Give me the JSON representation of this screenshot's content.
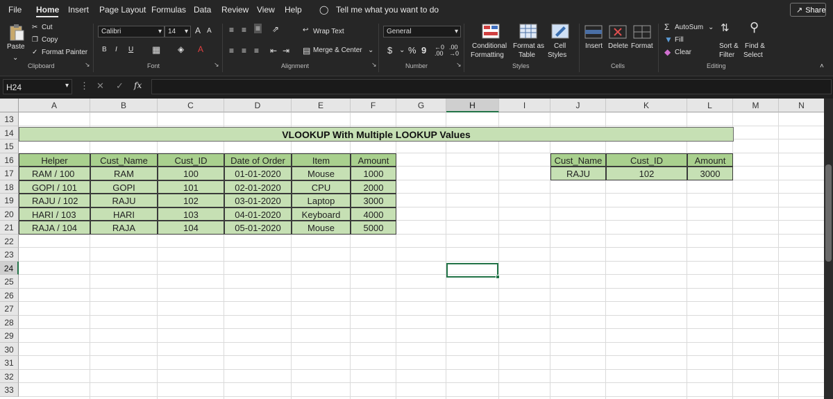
{
  "menu": {
    "tabs": [
      "File",
      "Home",
      "Insert",
      "Page Layout",
      "Formulas",
      "Data",
      "Review",
      "View",
      "Help"
    ],
    "tell_me": "Tell me what you want to do",
    "share": "Share"
  },
  "ribbon": {
    "clipboard": {
      "paste": "Paste",
      "cut": "Cut",
      "copy": "Copy",
      "format_painter": "Format Painter",
      "group": "Clipboard"
    },
    "font": {
      "name": "Calibri",
      "size": "14",
      "bold": "B",
      "italic": "I",
      "underline": "U",
      "group": "Font",
      "grow": "A",
      "shrink": "A"
    },
    "alignment": {
      "wrap": "Wrap Text",
      "merge": "Merge & Center",
      "group": "Alignment"
    },
    "number": {
      "format": "General",
      "currency": "$",
      "percent": "%",
      "comma": "9",
      "group": "Number"
    },
    "styles": {
      "conditional_1": "Conditional",
      "conditional_2": "Formatting",
      "format_as_1": "Format as",
      "format_as_2": "Table",
      "cell_1": "Cell",
      "cell_2": "Styles",
      "group": "Styles"
    },
    "cells": {
      "insert": "Insert",
      "delete": "Delete",
      "format": "Format",
      "group": "Cells"
    },
    "editing": {
      "autosum": "AutoSum",
      "fill": "Fill",
      "clear": "Clear",
      "sort_1": "Sort &",
      "sort_2": "Filter",
      "find_1": "Find &",
      "find_2": "Select",
      "group": "Editing"
    }
  },
  "formula_bar": {
    "name_box": "H24",
    "fx": "fx",
    "value": ""
  },
  "columns": [
    "A",
    "B",
    "C",
    "D",
    "E",
    "F",
    "G",
    "H",
    "I",
    "J",
    "K",
    "L",
    "M",
    "N"
  ],
  "rows": [
    "13",
    "14",
    "15",
    "16",
    "17",
    "18",
    "19",
    "20",
    "21",
    "22",
    "23",
    "24",
    "25",
    "26",
    "27",
    "28",
    "29",
    "30",
    "31",
    "32",
    "33"
  ],
  "title": "VLOOKUP With Multiple LOOKUP Values",
  "table": {
    "headers": [
      "Helper",
      "Cust_Name",
      "Cust_ID",
      "Date of Order",
      "Item",
      "Amount"
    ],
    "rows": [
      [
        "RAM / 100",
        "RAM",
        "100",
        "01-01-2020",
        "Mouse",
        "1000"
      ],
      [
        "GOPI / 101",
        "GOPI",
        "101",
        "02-01-2020",
        "CPU",
        "2000"
      ],
      [
        "RAJU / 102",
        "RAJU",
        "102",
        "03-01-2020",
        "Laptop",
        "3000"
      ],
      [
        "HARI / 103",
        "HARI",
        "103",
        "04-01-2020",
        "Keyboard",
        "4000"
      ],
      [
        "RAJA / 104",
        "RAJA",
        "104",
        "05-01-2020",
        "Mouse",
        "5000"
      ]
    ]
  },
  "lookup": {
    "headers": [
      "Cust_Name",
      "Cust_ID",
      "Amount"
    ],
    "values": [
      "RAJU",
      "102",
      "3000"
    ]
  }
}
